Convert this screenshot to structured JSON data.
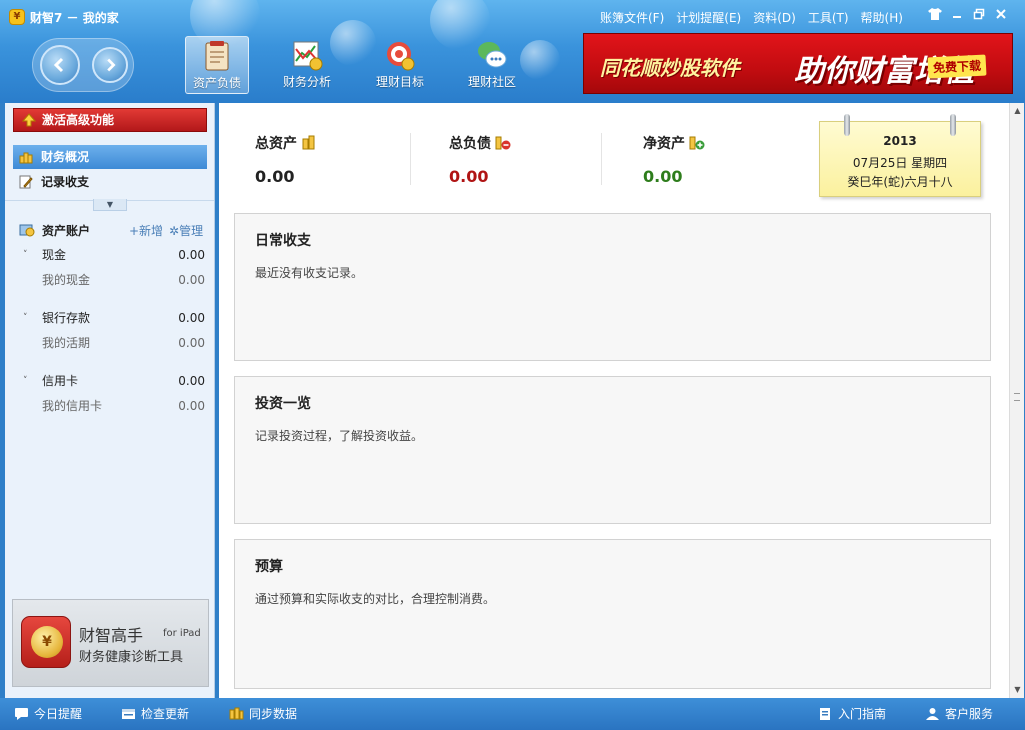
{
  "window": {
    "title": "财智7 － 我的家",
    "logo_char": "¥"
  },
  "menu": [
    "账簿文件(F)",
    "计划提醒(E)",
    "资料(D)",
    "工具(T)",
    "帮助(H)"
  ],
  "window_controls": [
    "shirt-icon",
    "minimize-icon",
    "restore-icon",
    "close-icon"
  ],
  "toolbar": {
    "buttons": [
      {
        "label": "资产负债",
        "icon": "ledger-icon",
        "active": true
      },
      {
        "label": "财务分析",
        "icon": "chart-icon",
        "active": false
      },
      {
        "label": "理财目标",
        "icon": "target-icon",
        "active": false
      },
      {
        "label": "理财社区",
        "icon": "community-icon",
        "active": false
      }
    ]
  },
  "ad": {
    "text1": "同花顺炒股软件",
    "text2": "助你财富增值",
    "badge": "免费下载"
  },
  "sidebar": {
    "activate_label": "激活高级功能",
    "nav": [
      {
        "label": "财务概况",
        "active": true
      },
      {
        "label": "记录收支",
        "active": false
      }
    ],
    "accounts_title": "资产账户",
    "add_label": "+新增",
    "manage_label": "管理",
    "groups": [
      {
        "name": "现金",
        "amount": "0.00",
        "sub_name": "我的现金",
        "sub_amount": "0.00"
      },
      {
        "name": "银行存款",
        "amount": "0.00",
        "sub_name": "我的活期",
        "sub_amount": "0.00"
      },
      {
        "name": "信用卡",
        "amount": "0.00",
        "sub_name": "我的信用卡",
        "sub_amount": "0.00"
      }
    ],
    "promo": {
      "name": "财智高手",
      "for": "for iPad",
      "sub": "财务健康诊断工具",
      "coin": "¥"
    }
  },
  "summary": {
    "total_assets_label": "总资产",
    "total_assets": "0.00",
    "total_debt_label": "总负债",
    "total_debt": "0.00",
    "net_assets_label": "净资产",
    "net_assets": "0.00"
  },
  "calendar": {
    "year": "2013",
    "date": "07月25日 星期四",
    "lunar": "癸巳年(蛇)六月十八"
  },
  "cards": [
    {
      "title": "日常收支",
      "desc": "最近没有收支记录。"
    },
    {
      "title": "投资一览",
      "desc": "记录投资过程，了解投资收益。"
    },
    {
      "title": "预算",
      "desc": "通过预算和实际收支的对比，合理控制消费。"
    }
  ],
  "statusbar": {
    "today_reminder": "今日提醒",
    "check_update": "检查更新",
    "sync_data": "同步数据",
    "guide": "入门指南",
    "customer_service": "客户服务"
  },
  "colors": {
    "accent_blue": "#3a93dc",
    "debt_red": "#b01414",
    "net_green": "#2e7d1c",
    "activate_red": "#c82a26"
  }
}
